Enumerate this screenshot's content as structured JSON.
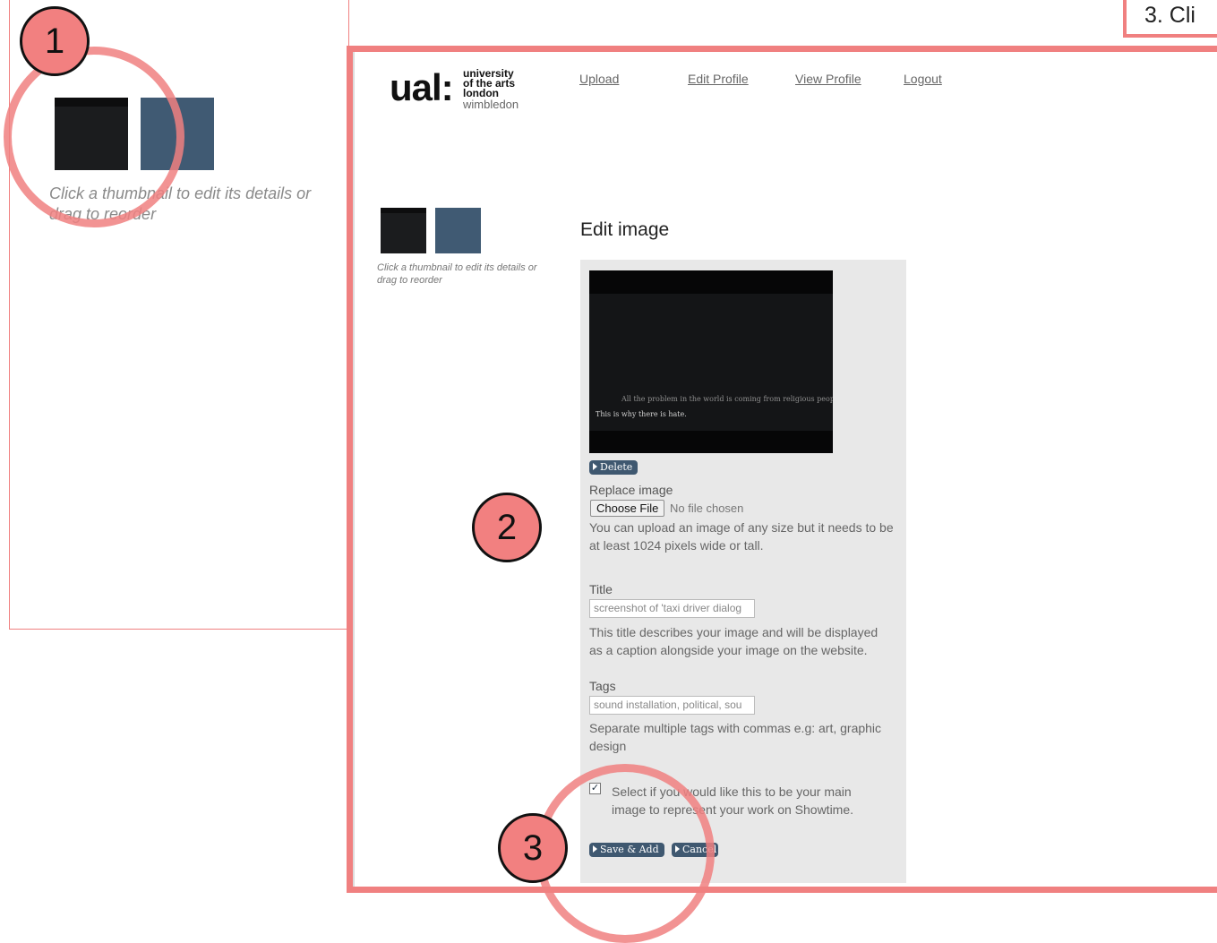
{
  "step_note": "3.  Cli",
  "background_panel": {
    "hint": "Click a thumbnail to edit its details or drag to reorder"
  },
  "logo": {
    "mark": "ual:",
    "line1": "university",
    "line2": "of the arts",
    "line3": "london",
    "line4": "wimbledon"
  },
  "nav": {
    "upload": "Upload",
    "edit_profile": "Edit Profile",
    "view_profile": "View Profile",
    "logout": "Logout"
  },
  "thumbnails_hint": "Click a thumbnail to edit its details or drag to reorder",
  "edit_form": {
    "heading": "Edit image",
    "preview_caption_1": "All the problem in the world is coming from religious people...",
    "preview_caption_2": "This is why there is hate.",
    "delete_label": "Delete",
    "replace_label": "Replace image",
    "choose_file_label": "Choose File",
    "file_status": "No file chosen",
    "replace_help": "You can upload an image of any size but it needs to be at least 1024 pixels wide or tall.",
    "title_label": "Title",
    "title_value": "screenshot of 'taxi driver dialog",
    "title_help": "This title describes your image and will be displayed as a caption alongside your image on the website.",
    "tags_label": "Tags",
    "tags_value": "sound installation, political, sou",
    "tags_help": "Separate multiple tags with commas e.g: art, graphic design",
    "main_image_label": "Select if you would like this to be your main image to represent your work on Showtime.",
    "main_image_checked": true,
    "save_label": "Save & Add",
    "cancel_label": "Cancel"
  },
  "annotations": {
    "badge1": "1",
    "badge2": "2",
    "badge3": "3",
    "accent_color": "#f08080"
  }
}
